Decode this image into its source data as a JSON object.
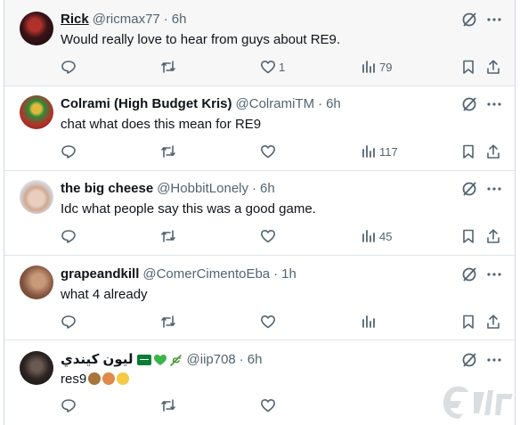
{
  "colors": {
    "text": "#0f1419",
    "muted": "#536471",
    "border": "#dfe4e8",
    "highlight_bg": "#f7f7f7"
  },
  "tweets": [
    {
      "name": "Rick",
      "handle": "@ricmax77",
      "separator": "·",
      "time": "6h",
      "text": "Would really love to hear from guys about RE9.",
      "likes": "1",
      "views": "79"
    },
    {
      "name": "Colrami (High Budget Kris)",
      "handle": "@ColramiTM",
      "separator": "·",
      "time": "6h",
      "text": "chat what does this mean for RE9",
      "likes": "",
      "views": "117"
    },
    {
      "name": "the big cheese",
      "handle": "@HobbitLonely",
      "separator": "·",
      "time": "6h",
      "text": "Idc what people say this was a good game.",
      "likes": "",
      "views": "45"
    },
    {
      "name": "grapeandkill",
      "handle": "@ComerCimentoEba",
      "separator": "·",
      "time": "1h",
      "text": "what 4 already",
      "likes": "",
      "views": ""
    },
    {
      "name": "ليون كيندي",
      "handle": "@iip708",
      "separator": "·",
      "time": "6h",
      "text": "res9",
      "likes": "",
      "views": ""
    }
  ],
  "icons": {
    "reply": "reply-icon",
    "retweet": "retweet-icon",
    "like": "heart-icon",
    "views": "views-icon",
    "bookmark": "bookmark-icon",
    "share": "share-icon",
    "grok": "grok-icon",
    "more": "more-icon"
  }
}
